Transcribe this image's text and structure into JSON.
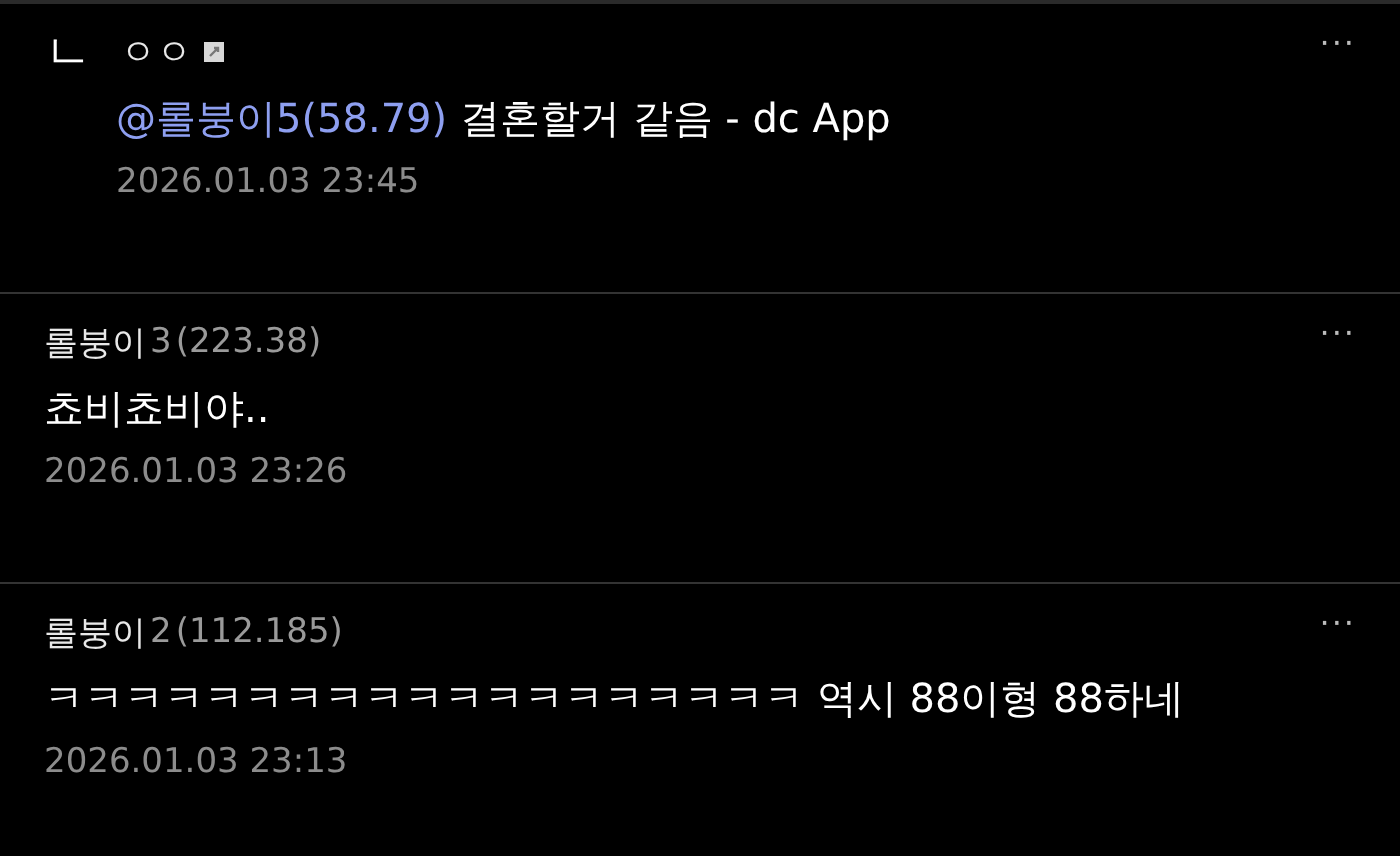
{
  "comments": [
    {
      "kind": "reply",
      "marker": "ㄴ",
      "name": "ㅇㅇ",
      "mention": "@롤붕이5(58.79)",
      "body": " 결혼할거 같음 - dc App",
      "date": "2026.01.03 23:45",
      "menu": "···"
    },
    {
      "kind": "comment",
      "name": "롤붕이",
      "tag": "3",
      "ip": "(223.38)",
      "body": "쵸비쵸비야..",
      "date": "2026.01.03 23:26",
      "menu": "···"
    },
    {
      "kind": "comment",
      "name": "롤붕이",
      "tag": "2",
      "ip": "(112.185)",
      "body": "ㅋㅋㅋㅋㅋㅋㅋㅋㅋㅋㅋㅋㅋㅋㅋㅋㅋㅋㅋ 역시 88이형 88하네",
      "date": "2026.01.03 23:13",
      "menu": "···"
    }
  ]
}
